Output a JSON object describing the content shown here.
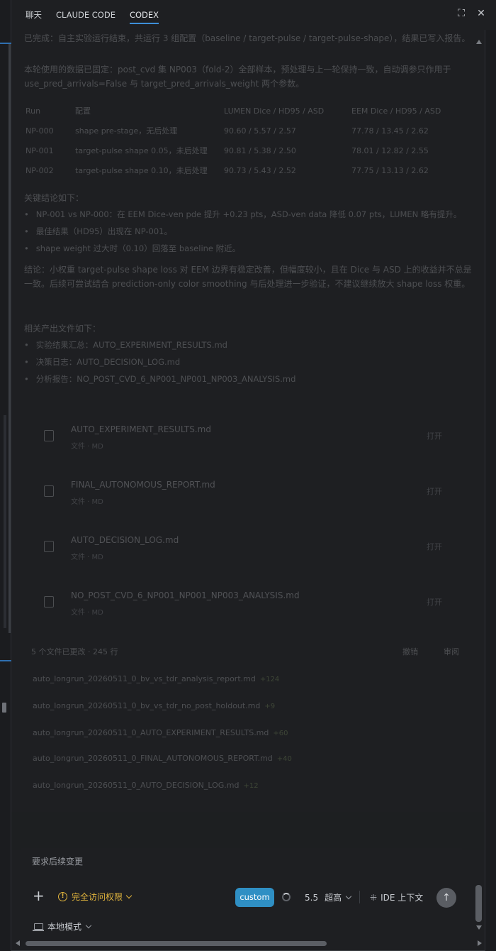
{
  "tabs": [
    {
      "label": "聊天",
      "active": false
    },
    {
      "label": "CLAUDE CODE",
      "active": false
    },
    {
      "label": "CODEX",
      "active": true
    }
  ],
  "window_actions": {
    "fullscreen_icon": "expand-icon",
    "close_icon": "close-icon"
  },
  "content": {
    "para1": "已完成：自主实验运行结束，共运行 3 组配置（baseline / target-pulse / target-pulse-shape），结果已写入报告。",
    "para2": "本轮使用的数据已固定：post_cvd 集 NP003（fold-2）全部样本，预处理与上一轮保持一致，自动调参只作用于 use_pred_arrivals=False 与 target_pred_arrivals_weight 两个参数。",
    "table_header": [
      "Run",
      "配置",
      "LUMEN Dice / HD95 / ASD",
      "EEM Dice / HD95 / ASD"
    ],
    "table_rows": [
      [
        "NP-000",
        "shape pre-stage，无后处理",
        "90.60 / 5.57 / 2.57",
        "77.78 / 13.45 / 2.62"
      ],
      [
        "NP-001",
        "target-pulse shape 0.05，未后处理",
        "90.81 / 5.38 / 2.50",
        "78.01 / 12.82 / 2.55"
      ],
      [
        "NP-002",
        "target-pulse shape 0.10，未后处理",
        "90.73 / 5.43 / 2.52",
        "77.75 / 13.13 / 2.62"
      ]
    ],
    "results_head": "关键结论如下：",
    "bullets1": [
      "NP-001 vs NP-000：在 EEM Dice-ven pde 提升 +0.23 pts，ASD-ven data 降低 0.07 pts，LUMEN 略有提升。",
      "最佳结果（HD95）出现在 NP-001。",
      "shape weight 过大时（0.10）回落至 baseline 附近。"
    ],
    "para3": "结论：小权重 target-pulse shape loss 对 EEM 边界有稳定改善，但幅度较小，且在 Dice 与 ASD 上的收益并不总是一致。后续可尝试结合 prediction-only color smoothing 与后处理进一步验证，不建议继续放大 shape loss 权重。",
    "files_head": "相关产出文件如下：",
    "bullets2": [
      "实验结果汇总：AUTO_EXPERIMENT_RESULTS.md",
      "决策日志：AUTO_DECISION_LOG.md",
      "分析报告：NO_POST_CVD_6_NP001_NP001_NP003_ANALYSIS.md"
    ],
    "files": [
      {
        "name": "AUTO_EXPERIMENT_RESULTS.md",
        "meta": "文件 · MD",
        "action": "打开"
      },
      {
        "name": "FINAL_AUTONOMOUS_REPORT.md",
        "meta": "文件 · MD",
        "action": "打开"
      },
      {
        "name": "AUTO_DECISION_LOG.md",
        "meta": "文件 · MD",
        "action": "打开"
      },
      {
        "name": "NO_POST_CVD_6_NP001_NP001_NP003_ANALYSIS.md",
        "meta": "文件 · MD",
        "action": "打开"
      }
    ],
    "changes_head": "5 个文件已更改 · 245 行",
    "changes_actions": [
      "撤销",
      "审阅"
    ],
    "changes": [
      {
        "name": "auto_longrun_20260511_0_bv_vs_tdr_analysis_report.md",
        "status": "+124"
      },
      {
        "name": "auto_longrun_20260511_0_bv_vs_tdr_no_post_holdout.md",
        "status": "+9"
      },
      {
        "name": "auto_longrun_20260511_0_AUTO_EXPERIMENT_RESULTS.md",
        "status": "+60"
      },
      {
        "name": "auto_longrun_20260511_0_FINAL_AUTONOMOUS_REPORT.md",
        "status": "+40"
      },
      {
        "name": "auto_longrun_20260511_0_AUTO_DECISION_LOG.md",
        "status": "+12"
      }
    ]
  },
  "input": {
    "placeholder": "要求后续变更",
    "permission_label": "完全访问权限",
    "mode_button": "custom",
    "model_version": "5.5",
    "model_tier": "超高",
    "ide_context": "IDE 上下文",
    "local_mode": "本地模式"
  },
  "colors": {
    "accent": "#3d8fd8",
    "custom_button": "#2f8fc4",
    "warning": "#e2b53d",
    "background": "#1e1f22"
  }
}
